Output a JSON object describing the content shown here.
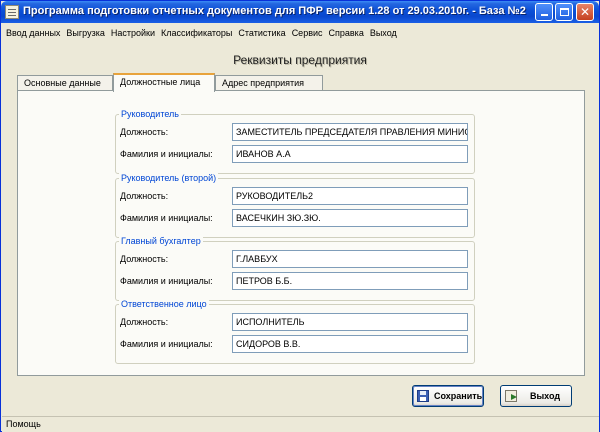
{
  "window": {
    "title": "Программа подготовки отчетных документов для ПФР версии 1.28 от 29.03.2010г. - База №2",
    "minimize_glyph": "",
    "maximize_glyph": "",
    "close_glyph": "✕"
  },
  "menu": [
    "Ввод данных",
    "Выгрузка",
    "Настройки",
    "Классификаторы",
    "Статистика",
    "Сервис",
    "Справка",
    "Выход"
  ],
  "header": {
    "title": "Реквизиты предприятия"
  },
  "tabs": [
    {
      "label": "Основные данные",
      "active": false
    },
    {
      "label": "Должностные лица",
      "active": true
    },
    {
      "label": "Адрес предприятия",
      "active": false
    }
  ],
  "groups": [
    {
      "title": "Руководитель",
      "position_label": "Должность:",
      "position_value": "ЗАМЕСТИТЕЛЬ ПРЕДСЕДАТЕЛЯ ПРАВЛЕНИЯ МИНИСТ",
      "name_label": "Фамилия и инициалы:",
      "name_value": "ИВАНОВ А.А"
    },
    {
      "title": "Руководитель (второй)",
      "position_label": "Должность:",
      "position_value": "РУКОВОДИТЕЛЬ2",
      "name_label": "Фамилия и инициалы:",
      "name_value": "ВАСЕЧКИН ЗЮ.ЗЮ."
    },
    {
      "title": "Главный бухгалтер",
      "position_label": "Должность:",
      "position_value": "Г.ЛАВБУХ",
      "name_label": "Фамилия и инициалы:",
      "name_value": "ПЕТРОВ Б.Б."
    },
    {
      "title": "Ответственное лицо",
      "position_label": "Должность:",
      "position_value": "ИСПОЛНИТЕЛЬ",
      "name_label": "Фамилия и инициалы:",
      "name_value": "СИДОРОВ В.В."
    }
  ],
  "buttons": {
    "save": "Сохранить",
    "exit": "Выход"
  },
  "status": {
    "text": "Помощь"
  },
  "colors": {
    "titlebar": "#0a48ce",
    "group_title": "#0046d5",
    "active_tab_accent": "#e8a33b"
  }
}
